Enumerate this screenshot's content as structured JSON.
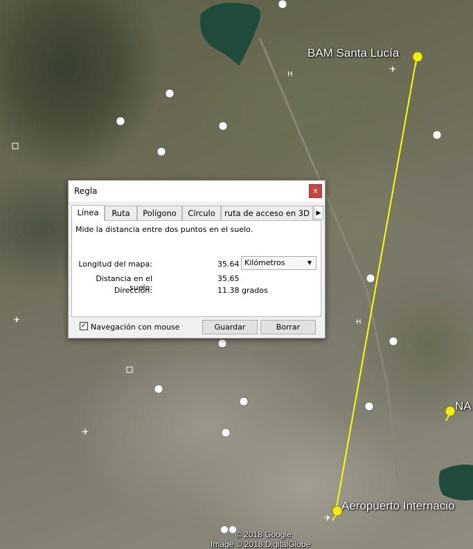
{
  "map": {
    "placemarks": [
      {
        "name": "BAM Santa Lucía"
      },
      {
        "name": "Aeropuerto Internacio"
      },
      {
        "name": "NA"
      }
    ],
    "copyright": [
      "© 2018 Google",
      "Image © 2018 DigitalGlobe"
    ],
    "colors": {
      "measure_line": "#ffff00",
      "pin": "#f2ee12",
      "water": "#1f4a3c"
    }
  },
  "dialog": {
    "title": "Regla",
    "close": "x",
    "tabs": [
      "Línea",
      "Ruta",
      "Polígono",
      "Círculo",
      "ruta de acceso en 3D"
    ],
    "active_tab": "Línea",
    "description": "Mide la distancia entre dos puntos en el suelo.",
    "map_length_label": "Longitud del mapa:",
    "map_length_value": "35.64",
    "unit_selected": "Kilómetros",
    "ground_distance_label": "Distancia en el suelo:",
    "ground_distance_value": "35.65",
    "heading_label": "Dirección:",
    "heading_value": "11.38 grados",
    "mouse_nav_label": "Navegación con mouse",
    "mouse_nav_checked": true,
    "save_button": "Guardar",
    "clear_button": "Borrar"
  }
}
